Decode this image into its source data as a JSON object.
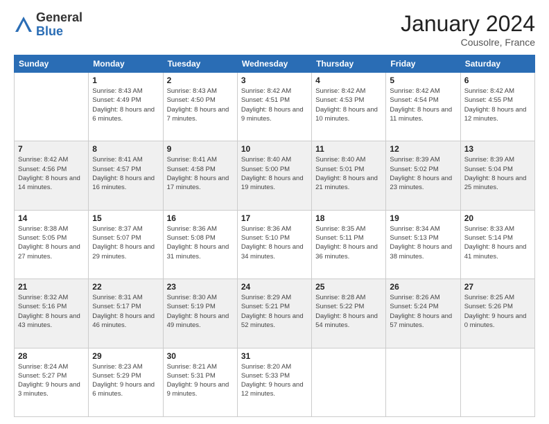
{
  "logo": {
    "general": "General",
    "blue": "Blue"
  },
  "title": "January 2024",
  "location": "Cousolre, France",
  "weekdays": [
    "Sunday",
    "Monday",
    "Tuesday",
    "Wednesday",
    "Thursday",
    "Friday",
    "Saturday"
  ],
  "weeks": [
    [
      {
        "day": "",
        "sunrise": "",
        "sunset": "",
        "daylight": ""
      },
      {
        "day": "1",
        "sunrise": "Sunrise: 8:43 AM",
        "sunset": "Sunset: 4:49 PM",
        "daylight": "Daylight: 8 hours and 6 minutes."
      },
      {
        "day": "2",
        "sunrise": "Sunrise: 8:43 AM",
        "sunset": "Sunset: 4:50 PM",
        "daylight": "Daylight: 8 hours and 7 minutes."
      },
      {
        "day": "3",
        "sunrise": "Sunrise: 8:42 AM",
        "sunset": "Sunset: 4:51 PM",
        "daylight": "Daylight: 8 hours and 9 minutes."
      },
      {
        "day": "4",
        "sunrise": "Sunrise: 8:42 AM",
        "sunset": "Sunset: 4:53 PM",
        "daylight": "Daylight: 8 hours and 10 minutes."
      },
      {
        "day": "5",
        "sunrise": "Sunrise: 8:42 AM",
        "sunset": "Sunset: 4:54 PM",
        "daylight": "Daylight: 8 hours and 11 minutes."
      },
      {
        "day": "6",
        "sunrise": "Sunrise: 8:42 AM",
        "sunset": "Sunset: 4:55 PM",
        "daylight": "Daylight: 8 hours and 12 minutes."
      }
    ],
    [
      {
        "day": "7",
        "sunrise": "Sunrise: 8:42 AM",
        "sunset": "Sunset: 4:56 PM",
        "daylight": "Daylight: 8 hours and 14 minutes."
      },
      {
        "day": "8",
        "sunrise": "Sunrise: 8:41 AM",
        "sunset": "Sunset: 4:57 PM",
        "daylight": "Daylight: 8 hours and 16 minutes."
      },
      {
        "day": "9",
        "sunrise": "Sunrise: 8:41 AM",
        "sunset": "Sunset: 4:58 PM",
        "daylight": "Daylight: 8 hours and 17 minutes."
      },
      {
        "day": "10",
        "sunrise": "Sunrise: 8:40 AM",
        "sunset": "Sunset: 5:00 PM",
        "daylight": "Daylight: 8 hours and 19 minutes."
      },
      {
        "day": "11",
        "sunrise": "Sunrise: 8:40 AM",
        "sunset": "Sunset: 5:01 PM",
        "daylight": "Daylight: 8 hours and 21 minutes."
      },
      {
        "day": "12",
        "sunrise": "Sunrise: 8:39 AM",
        "sunset": "Sunset: 5:02 PM",
        "daylight": "Daylight: 8 hours and 23 minutes."
      },
      {
        "day": "13",
        "sunrise": "Sunrise: 8:39 AM",
        "sunset": "Sunset: 5:04 PM",
        "daylight": "Daylight: 8 hours and 25 minutes."
      }
    ],
    [
      {
        "day": "14",
        "sunrise": "Sunrise: 8:38 AM",
        "sunset": "Sunset: 5:05 PM",
        "daylight": "Daylight: 8 hours and 27 minutes."
      },
      {
        "day": "15",
        "sunrise": "Sunrise: 8:37 AM",
        "sunset": "Sunset: 5:07 PM",
        "daylight": "Daylight: 8 hours and 29 minutes."
      },
      {
        "day": "16",
        "sunrise": "Sunrise: 8:36 AM",
        "sunset": "Sunset: 5:08 PM",
        "daylight": "Daylight: 8 hours and 31 minutes."
      },
      {
        "day": "17",
        "sunrise": "Sunrise: 8:36 AM",
        "sunset": "Sunset: 5:10 PM",
        "daylight": "Daylight: 8 hours and 34 minutes."
      },
      {
        "day": "18",
        "sunrise": "Sunrise: 8:35 AM",
        "sunset": "Sunset: 5:11 PM",
        "daylight": "Daylight: 8 hours and 36 minutes."
      },
      {
        "day": "19",
        "sunrise": "Sunrise: 8:34 AM",
        "sunset": "Sunset: 5:13 PM",
        "daylight": "Daylight: 8 hours and 38 minutes."
      },
      {
        "day": "20",
        "sunrise": "Sunrise: 8:33 AM",
        "sunset": "Sunset: 5:14 PM",
        "daylight": "Daylight: 8 hours and 41 minutes."
      }
    ],
    [
      {
        "day": "21",
        "sunrise": "Sunrise: 8:32 AM",
        "sunset": "Sunset: 5:16 PM",
        "daylight": "Daylight: 8 hours and 43 minutes."
      },
      {
        "day": "22",
        "sunrise": "Sunrise: 8:31 AM",
        "sunset": "Sunset: 5:17 PM",
        "daylight": "Daylight: 8 hours and 46 minutes."
      },
      {
        "day": "23",
        "sunrise": "Sunrise: 8:30 AM",
        "sunset": "Sunset: 5:19 PM",
        "daylight": "Daylight: 8 hours and 49 minutes."
      },
      {
        "day": "24",
        "sunrise": "Sunrise: 8:29 AM",
        "sunset": "Sunset: 5:21 PM",
        "daylight": "Daylight: 8 hours and 52 minutes."
      },
      {
        "day": "25",
        "sunrise": "Sunrise: 8:28 AM",
        "sunset": "Sunset: 5:22 PM",
        "daylight": "Daylight: 8 hours and 54 minutes."
      },
      {
        "day": "26",
        "sunrise": "Sunrise: 8:26 AM",
        "sunset": "Sunset: 5:24 PM",
        "daylight": "Daylight: 8 hours and 57 minutes."
      },
      {
        "day": "27",
        "sunrise": "Sunrise: 8:25 AM",
        "sunset": "Sunset: 5:26 PM",
        "daylight": "Daylight: 9 hours and 0 minutes."
      }
    ],
    [
      {
        "day": "28",
        "sunrise": "Sunrise: 8:24 AM",
        "sunset": "Sunset: 5:27 PM",
        "daylight": "Daylight: 9 hours and 3 minutes."
      },
      {
        "day": "29",
        "sunrise": "Sunrise: 8:23 AM",
        "sunset": "Sunset: 5:29 PM",
        "daylight": "Daylight: 9 hours and 6 minutes."
      },
      {
        "day": "30",
        "sunrise": "Sunrise: 8:21 AM",
        "sunset": "Sunset: 5:31 PM",
        "daylight": "Daylight: 9 hours and 9 minutes."
      },
      {
        "day": "31",
        "sunrise": "Sunrise: 8:20 AM",
        "sunset": "Sunset: 5:33 PM",
        "daylight": "Daylight: 9 hours and 12 minutes."
      },
      {
        "day": "",
        "sunrise": "",
        "sunset": "",
        "daylight": ""
      },
      {
        "day": "",
        "sunrise": "",
        "sunset": "",
        "daylight": ""
      },
      {
        "day": "",
        "sunrise": "",
        "sunset": "",
        "daylight": ""
      }
    ]
  ]
}
